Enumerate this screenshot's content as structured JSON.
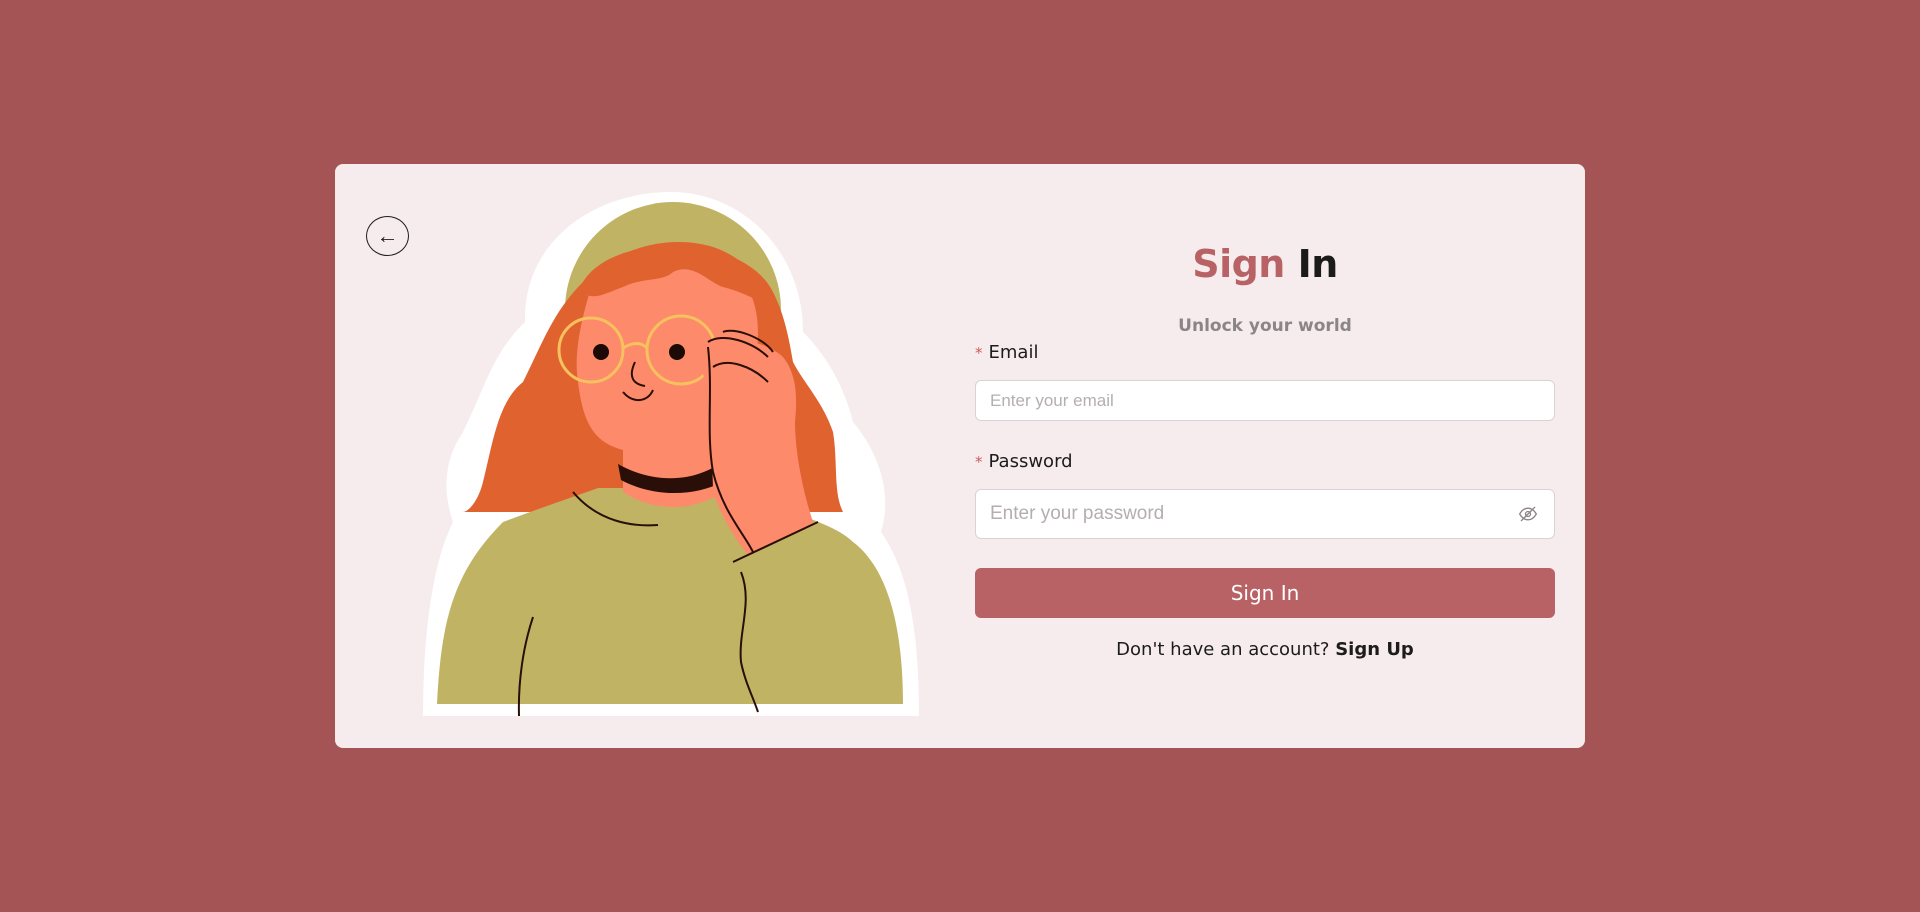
{
  "back": {
    "icon": "arrow-left-icon",
    "glyph": "←"
  },
  "form": {
    "title_part1": "Sign",
    "title_part2": "In",
    "subtitle": "Unlock your world",
    "required_mark": "*",
    "email": {
      "label": "Email",
      "placeholder": "Enter your email",
      "value": ""
    },
    "password": {
      "label": "Password",
      "placeholder": "Enter your password",
      "value": "",
      "toggle_icon": "eye-off-icon"
    },
    "submit_label": "Sign In",
    "signup_prompt": "Don't have an account?",
    "signup_link": "Sign Up"
  },
  "colors": {
    "background": "#a55456",
    "card": "#f6eced",
    "accent": "#b86266",
    "text": "#1c1c1c",
    "muted": "#8b8586"
  }
}
